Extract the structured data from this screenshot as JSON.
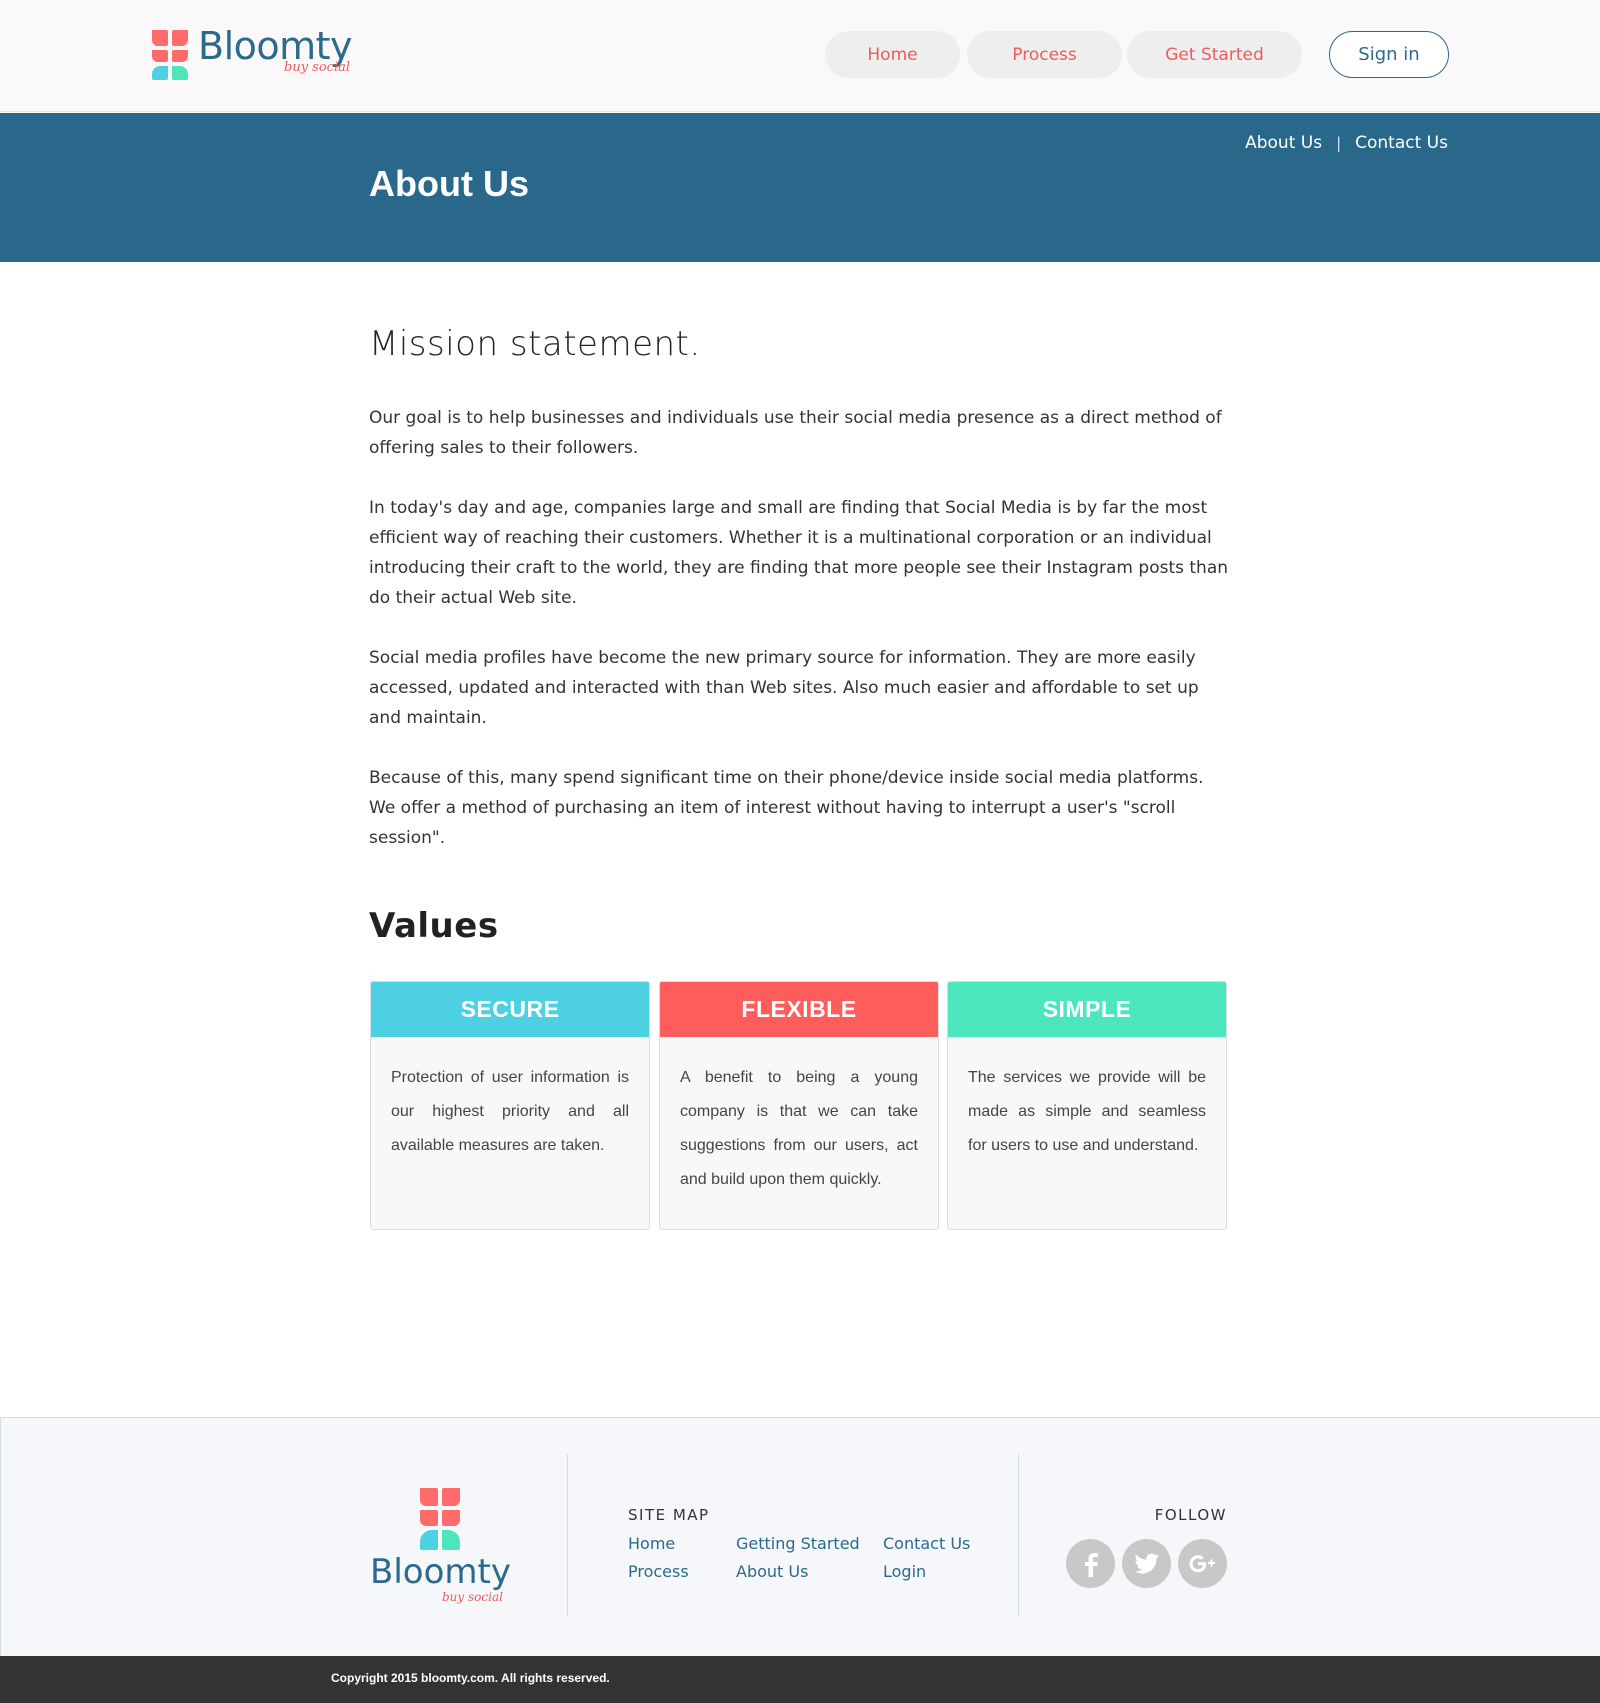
{
  "header": {
    "logo_text": "Bloomty",
    "logo_tagline": "buy social",
    "nav": [
      "Home",
      "Process",
      "Get Started"
    ],
    "signin_label": "Sign in"
  },
  "banner": {
    "title": "About Us",
    "links": [
      "About Us",
      "Contact Us"
    ],
    "separator": "|"
  },
  "main": {
    "mission_heading": "Mission statement.",
    "paragraphs": [
      "Our goal is to help businesses and individuals use their social media presence as a direct method of offering sales to their followers.",
      "In today's day and age, companies large and small are finding that Social Media is by far the most efficient way of reaching their customers. Whether it is a multinational corporation or an individual introducing their craft to the world, they are finding that more people see their Instagram posts than do their actual Web site.",
      "Social media profiles have become the new primary source for information. They are more easily accessed, updated and interacted with than Web sites. Also much easier and affordable to set up and maintain.",
      "Because of this, many spend significant time on their phone/device inside social media platforms. We offer a method of purchasing an item of interest without having to interrupt a user's \"scroll session\"."
    ],
    "values_heading": "Values",
    "values": [
      {
        "title": "SECURE",
        "color": "#4dd0e1",
        "text": "Protection of user information is our highest priority and all available measures are taken."
      },
      {
        "title": "FLEXIBLE",
        "color": "#ff5c5c",
        "text": "A benefit to being a young company is that we can take suggestions from our users, act and build upon them quickly."
      },
      {
        "title": "SIMPLE",
        "color": "#4ce6bd",
        "text": "The services we provide will be made as simple and seamless for users to use and understand."
      }
    ]
  },
  "footer": {
    "logo_text": "Bloomty",
    "logo_tagline": "buy social",
    "sitemap_title": "SITE MAP",
    "sitemap_links": [
      "Home",
      "Process",
      "Getting Started",
      "About Us",
      "Contact Us",
      "Login"
    ],
    "follow_title": "FOLLOW",
    "social": [
      {
        "icon": "facebook-icon",
        "glyph": "f"
      },
      {
        "icon": "twitter-icon",
        "glyph": "🐦"
      },
      {
        "icon": "google-plus-icon",
        "glyph": "g+"
      }
    ],
    "copyright": "Copyright 2015 bloomty.com. All rights reserved."
  },
  "colors": {
    "brand_blue": "#2a6a8c",
    "brand_coral": "#f05a5a",
    "banner_bg": "#29688a",
    "footer_bg": "#f5f7fa",
    "copyright_bg": "#333333"
  }
}
